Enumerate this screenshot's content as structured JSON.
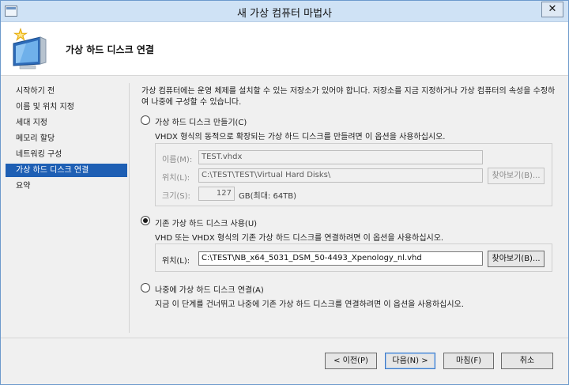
{
  "window": {
    "title": "새 가상 컴퓨터 마법사",
    "close_glyph": "✕"
  },
  "header": {
    "title": "가상 하드 디스크 연결",
    "icon": "monitor-star-icon"
  },
  "nav": {
    "items": [
      {
        "label": "시작하기 전",
        "active": false
      },
      {
        "label": "이름 및 위치 지정",
        "active": false
      },
      {
        "label": "세대 지정",
        "active": false
      },
      {
        "label": "메모리 할당",
        "active": false
      },
      {
        "label": "네트워킹 구성",
        "active": false
      },
      {
        "label": "가상 하드 디스크 연결",
        "active": true
      },
      {
        "label": "요약",
        "active": false
      }
    ]
  },
  "content": {
    "intro": "가상 컴퓨터에는 운영 체제를 설치할 수 있는 저장소가 있어야 합니다. 저장소를 지금 지정하거나 가상 컴퓨터의 속성을 수정하여 나중에 구성할 수 있습니다.",
    "create_option": {
      "label": "가상 하드 디스크 만들기(C)",
      "selected": false,
      "description": "VHDX 형식의 동적으로 확장되는 가상 하드 디스크를 만들려면 이 옵션을 사용하십시오.",
      "name_label": "이름(M):",
      "name_value": "TEST.vhdx",
      "location_label": "위치(L):",
      "location_value": "C:\\TEST\\TEST\\Virtual Hard Disks\\",
      "browse_label": "찾아보기(B)...",
      "size_label": "크기(S):",
      "size_value": "127",
      "size_unit": "GB(최대: 64TB)"
    },
    "existing_option": {
      "label": "기존 가상 하드 디스크 사용(U)",
      "selected": true,
      "description": "VHD 또는 VHDX 형식의 기존 가상 하드 디스크를 연결하려면 이 옵션을 사용하십시오.",
      "location_label": "위치(L):",
      "location_value": "C:\\TEST\\NB_x64_5031_DSM_50-4493_Xpenology_nl.vhd",
      "browse_label": "찾아보기(B)..."
    },
    "later_option": {
      "label": "나중에 가상 하드 디스크 연결(A)",
      "selected": false,
      "description": "지금 이 단계를 건너뛰고 나중에 기존 가상 하드 디스크를 연결하려면 이 옵션을 사용하십시오."
    }
  },
  "footer": {
    "prev_label": "< 이전(P)",
    "next_label": "다음(N) >",
    "finish_label": "마침(F)",
    "cancel_label": "취소"
  },
  "colors": {
    "nav_active": "#1e5fb4",
    "titlebar": "#cfe2f5"
  }
}
